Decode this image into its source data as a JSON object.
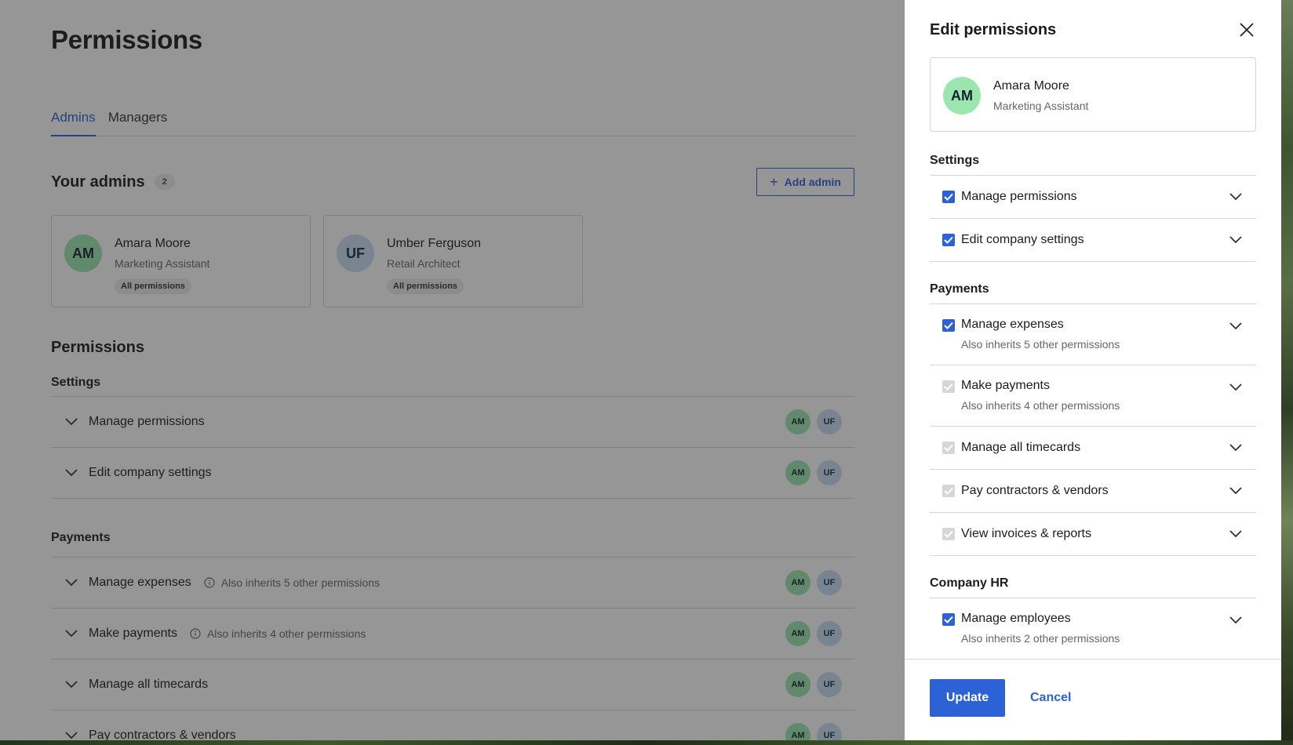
{
  "page": {
    "title": "Permissions",
    "tabs": [
      {
        "label": "Admins",
        "active": true
      },
      {
        "label": "Managers",
        "active": false
      }
    ],
    "admins_title": "Your admins",
    "admins_count": "2",
    "add_admin_label": "Add admin",
    "admins": [
      {
        "initials": "AM",
        "name": "Amara Moore",
        "role": "Marketing Assistant",
        "badge": "All permissions"
      },
      {
        "initials": "UF",
        "name": "Umber Ferguson",
        "role": "Retail Architect",
        "badge": "All permissions"
      }
    ],
    "permissions_title": "Permissions",
    "sections": [
      {
        "title": "Settings",
        "rows": [
          {
            "label": "Manage permissions",
            "info": "",
            "avatars": [
              "AM",
              "UF"
            ]
          },
          {
            "label": "Edit company settings",
            "info": "",
            "avatars": [
              "AM",
              "UF"
            ]
          }
        ]
      },
      {
        "title": "Payments",
        "rows": [
          {
            "label": "Manage expenses",
            "info": "Also inherits 5 other permissions",
            "avatars": [
              "AM",
              "UF"
            ]
          },
          {
            "label": "Make payments",
            "info": "Also inherits 4 other permissions",
            "avatars": [
              "AM",
              "UF"
            ]
          },
          {
            "label": "Manage all timecards",
            "info": "",
            "avatars": [
              "AM",
              "UF"
            ]
          },
          {
            "label": "Pay contractors & vendors",
            "info": "",
            "avatars": [
              "AM",
              "UF"
            ]
          }
        ]
      }
    ]
  },
  "panel": {
    "title": "Edit permissions",
    "user": {
      "initials": "AM",
      "name": "Amara Moore",
      "role": "Marketing Assistant"
    },
    "sections": [
      {
        "title": "Settings",
        "items": [
          {
            "label": "Manage permissions",
            "sub": "",
            "state": "checked"
          },
          {
            "label": "Edit company settings",
            "sub": "",
            "state": "checked"
          }
        ]
      },
      {
        "title": "Payments",
        "items": [
          {
            "label": "Manage expenses",
            "sub": "Also inherits 5 other permissions",
            "state": "checked"
          },
          {
            "label": "Make payments",
            "sub": "Also inherits 4 other permissions",
            "state": "disabled"
          },
          {
            "label": "Manage all timecards",
            "sub": "",
            "state": "disabled"
          },
          {
            "label": "Pay contractors & vendors",
            "sub": "",
            "state": "disabled"
          },
          {
            "label": "View invoices & reports",
            "sub": "",
            "state": "disabled"
          }
        ]
      },
      {
        "title": "Company HR",
        "items": [
          {
            "label": "Manage employees",
            "sub": "Also inherits 2 other permissions",
            "state": "checked"
          }
        ]
      }
    ],
    "update_label": "Update",
    "cancel_label": "Cancel"
  },
  "colors": {
    "accent": "#2c62d6",
    "avatar_am": "#9be6ae",
    "avatar_uf": "#c9def6",
    "overlay": "rgba(32,32,32,0.47)"
  }
}
